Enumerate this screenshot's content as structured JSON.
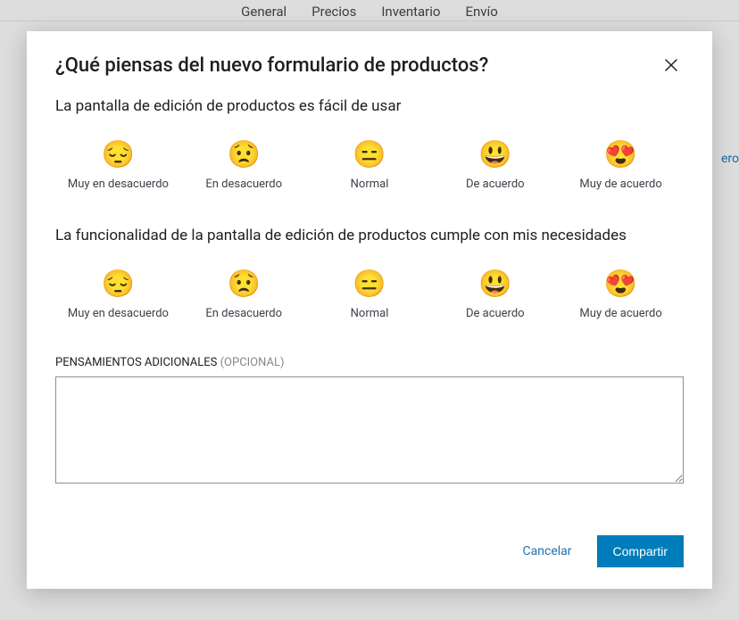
{
  "bg": {
    "tabs": [
      "General",
      "Precios",
      "Inventario",
      "Envío"
    ],
    "side": "ero"
  },
  "modal": {
    "title": "¿Qué piensas del nuevo formulario de productos?",
    "scale_labels": {
      "1": "Muy en desacuerdo",
      "2": "En desacuerdo",
      "3": "Normal",
      "4": "De acuerdo",
      "5": "Muy de acuerdo"
    },
    "scale_emojis": {
      "1": "😔",
      "2": "😟",
      "3": "😑",
      "4": "😃",
      "5": "😍"
    },
    "q1": "La pantalla de edición de productos es fácil de usar",
    "q2": "La funcionalidad de la pantalla de edición de productos cumple con mis necesidades",
    "comments": {
      "label": "PENSAMIENTOS ADICIONALES",
      "optional": "(OPCIONAL)",
      "value": ""
    },
    "footer": {
      "cancel": "Cancelar",
      "submit": "Compartir"
    }
  }
}
